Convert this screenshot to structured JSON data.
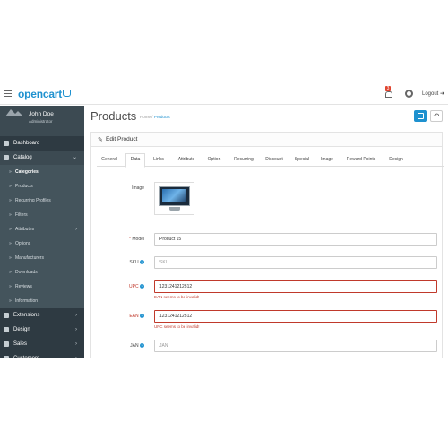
{
  "header": {
    "logo_text": "opencart",
    "notification_count": "3",
    "logout_label": "Logout"
  },
  "user": {
    "name": "John Doe",
    "role": "Administrator"
  },
  "sidebar": {
    "items": [
      {
        "label": "Dashboard"
      },
      {
        "label": "Catalog"
      },
      {
        "label": "Extensions"
      },
      {
        "label": "Design"
      },
      {
        "label": "Sales"
      },
      {
        "label": "Customers"
      }
    ],
    "catalog_sub": [
      {
        "label": "Categories"
      },
      {
        "label": "Products"
      },
      {
        "label": "Recurring Profiles"
      },
      {
        "label": "Filters"
      },
      {
        "label": "Attributes"
      },
      {
        "label": "Options"
      },
      {
        "label": "Manufacturers"
      },
      {
        "label": "Downloads"
      },
      {
        "label": "Reviews"
      },
      {
        "label": "Information"
      }
    ]
  },
  "page": {
    "title": "Products",
    "breadcrumb_home": "Home",
    "breadcrumb_sep": "/",
    "breadcrumb_current": "Products",
    "panel_title": "Edit Product"
  },
  "tabs": [
    "General",
    "Data",
    "Links",
    "Attribute",
    "Option",
    "Recurring",
    "Discount",
    "Special",
    "Image",
    "Reward Points",
    "Design"
  ],
  "form": {
    "image_label": "Image",
    "model_label": "Model",
    "model_value": "Product 15",
    "sku_label": "SKU",
    "sku_placeholder": "SKU",
    "upc_label": "UPC",
    "upc_value": "1231241212312",
    "upc_error": "EAN seems to be invalid!",
    "ean_label": "EAN",
    "ean_value": "1231241212312",
    "ean_error": "UPC seems to be invalid!",
    "jan_label": "JAN",
    "jan_placeholder": "JAN"
  },
  "colors": {
    "accent": "#1e91cf",
    "sidebar_bg": "#2e3a42",
    "error": "#c0392b"
  }
}
